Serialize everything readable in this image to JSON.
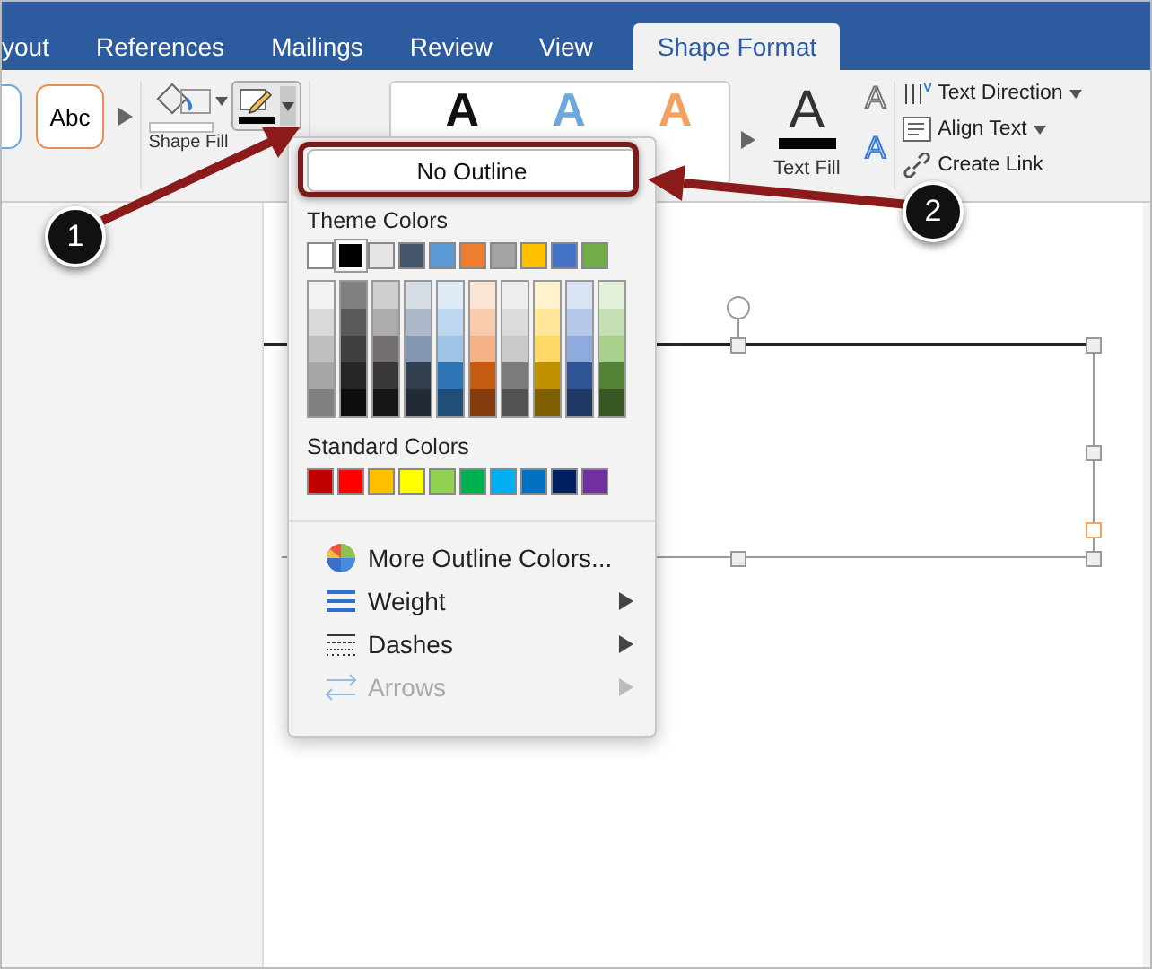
{
  "tabs": [
    {
      "label": "yout",
      "selected": false
    },
    {
      "label": "References",
      "selected": false
    },
    {
      "label": "Mailings",
      "selected": false
    },
    {
      "label": "Review",
      "selected": false
    },
    {
      "label": "View",
      "selected": false
    },
    {
      "label": "Shape Format",
      "selected": true
    }
  ],
  "ribbon": {
    "shape_style_sample": "Abc",
    "shape_fill_label": "Shape Fill",
    "wordart_styles": [
      {
        "label": "A",
        "color": "#111111"
      },
      {
        "label": "A",
        "color": "#6aa8de"
      },
      {
        "label": "A",
        "color": "#f4a15f"
      }
    ],
    "text_fill": {
      "glyph": "A",
      "label": "Text Fill"
    },
    "text_outline_glyph": "A",
    "text_effects_glyph": "A",
    "text_commands": [
      {
        "label": "Text Direction",
        "has_menu": true
      },
      {
        "label": "Align Text",
        "has_menu": true
      },
      {
        "label": "Create Link",
        "has_menu": false
      }
    ]
  },
  "outline_menu": {
    "no_outline": "No Outline",
    "theme_title": "Theme Colors",
    "theme_colors": [
      {
        "color": "#ffffff",
        "selected": false
      },
      {
        "color": "#000000",
        "selected": true
      },
      {
        "color": "#e7e6e6",
        "selected": false
      },
      {
        "color": "#44546a",
        "selected": false
      },
      {
        "color": "#5b9bd5",
        "selected": false
      },
      {
        "color": "#ed7d31",
        "selected": false
      },
      {
        "color": "#a5a5a5",
        "selected": false
      },
      {
        "color": "#ffc000",
        "selected": false
      },
      {
        "color": "#4472c4",
        "selected": false
      },
      {
        "color": "#70ad47",
        "selected": false
      }
    ],
    "theme_shades": [
      [
        {
          "color": "#f2f2f2"
        },
        {
          "color": "#d9d9d9"
        },
        {
          "color": "#bfbfbf"
        },
        {
          "color": "#a6a6a6"
        },
        {
          "color": "#808080"
        }
      ],
      [
        {
          "color": "#7f7f7f"
        },
        {
          "color": "#595959"
        },
        {
          "color": "#404040"
        },
        {
          "color": "#262626"
        },
        {
          "color": "#0d0d0d"
        }
      ],
      [
        {
          "color": "#d0cece"
        },
        {
          "color": "#aeabab"
        },
        {
          "color": "#757070"
        },
        {
          "color": "#3a3838"
        },
        {
          "color": "#171616"
        }
      ],
      [
        {
          "color": "#d6dce4"
        },
        {
          "color": "#adb9ca"
        },
        {
          "color": "#8496b0"
        },
        {
          "color": "#323f4f"
        },
        {
          "color": "#222a35"
        }
      ],
      [
        {
          "color": "#deebf6"
        },
        {
          "color": "#bdd7ee"
        },
        {
          "color": "#9dc3e6"
        },
        {
          "color": "#2e75b5"
        },
        {
          "color": "#1f4e79"
        }
      ],
      [
        {
          "color": "#fbe5d5"
        },
        {
          "color": "#f8cbad"
        },
        {
          "color": "#f4b183"
        },
        {
          "color": "#c55a11"
        },
        {
          "color": "#843c0c"
        }
      ],
      [
        {
          "color": "#ededed"
        },
        {
          "color": "#dbdbdb"
        },
        {
          "color": "#c9c9c9"
        },
        {
          "color": "#7b7b7b"
        },
        {
          "color": "#525252"
        }
      ],
      [
        {
          "color": "#fff2cc"
        },
        {
          "color": "#ffe699"
        },
        {
          "color": "#ffd966"
        },
        {
          "color": "#bf9000"
        },
        {
          "color": "#7f6000"
        }
      ],
      [
        {
          "color": "#dae3f3"
        },
        {
          "color": "#b4c7e7"
        },
        {
          "color": "#8faadc"
        },
        {
          "color": "#2f5597"
        },
        {
          "color": "#1f3864"
        }
      ],
      [
        {
          "color": "#e2f0d9"
        },
        {
          "color": "#c5e0b4"
        },
        {
          "color": "#a9d18e"
        },
        {
          "color": "#538135"
        },
        {
          "color": "#385723"
        }
      ]
    ],
    "standard_title": "Standard Colors",
    "standard_colors": [
      {
        "color": "#c00000"
      },
      {
        "color": "#ff0000"
      },
      {
        "color": "#ffc000"
      },
      {
        "color": "#ffff00"
      },
      {
        "color": "#92d050"
      },
      {
        "color": "#00b050"
      },
      {
        "color": "#00b0f0"
      },
      {
        "color": "#0070c0"
      },
      {
        "color": "#002060"
      },
      {
        "color": "#7030a0"
      }
    ],
    "items": [
      {
        "kind": "colors",
        "label": "More Outline Colors...",
        "submenu": false,
        "disabled": false
      },
      {
        "kind": "weight",
        "label": "Weight",
        "submenu": true,
        "disabled": false
      },
      {
        "kind": "dashes",
        "label": "Dashes",
        "submenu": true,
        "disabled": false
      },
      {
        "kind": "arrows",
        "label": "Arrows",
        "submenu": true,
        "disabled": true
      }
    ]
  },
  "callouts": [
    {
      "label": "1"
    },
    {
      "label": "2"
    }
  ]
}
